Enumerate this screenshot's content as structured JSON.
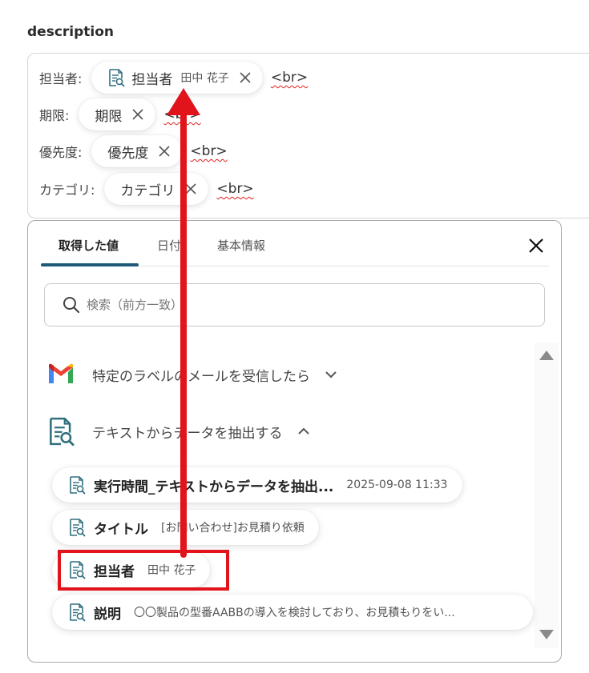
{
  "section_title": "description",
  "description": {
    "rows": [
      {
        "label": "担当者:",
        "chip_name": "担当者",
        "chip_value": "田中 花子",
        "tag": "<br>"
      },
      {
        "label": "期限:",
        "chip_name": "期限",
        "tag": "<br>"
      },
      {
        "label": "優先度:",
        "chip_name": "優先度",
        "tag": "<br>"
      },
      {
        "label": "カテゴリ:",
        "chip_name": "カテゴリ",
        "tag": "<br>"
      }
    ]
  },
  "popup": {
    "tabs": [
      "取得した値",
      "日付",
      "基本情報"
    ],
    "search_placeholder": "検索（前方一致）",
    "groups": [
      {
        "label": "特定のラベルのメールを受信したら",
        "icon": "gmail-icon",
        "expanded": false
      },
      {
        "label": "テキストからデータを抽出する",
        "icon": "document-search-icon",
        "expanded": true
      }
    ],
    "items": [
      {
        "name": "実行時間_テキストからデータを抽出...",
        "value": "2025-09-08 11:33"
      },
      {
        "name": "タイトル",
        "value": "[お問い合わせ]お見積り依頼"
      },
      {
        "name": "担当者",
        "value": "田中 花子"
      },
      {
        "name": "説明",
        "value": "〇〇製品の型番AABBの導入を検討しており、お見積もりをい..."
      }
    ]
  },
  "colors": {
    "accent": "#1f5a7a",
    "annotation_red": "#e0141a",
    "icon_teal": "#2f6f7e"
  }
}
